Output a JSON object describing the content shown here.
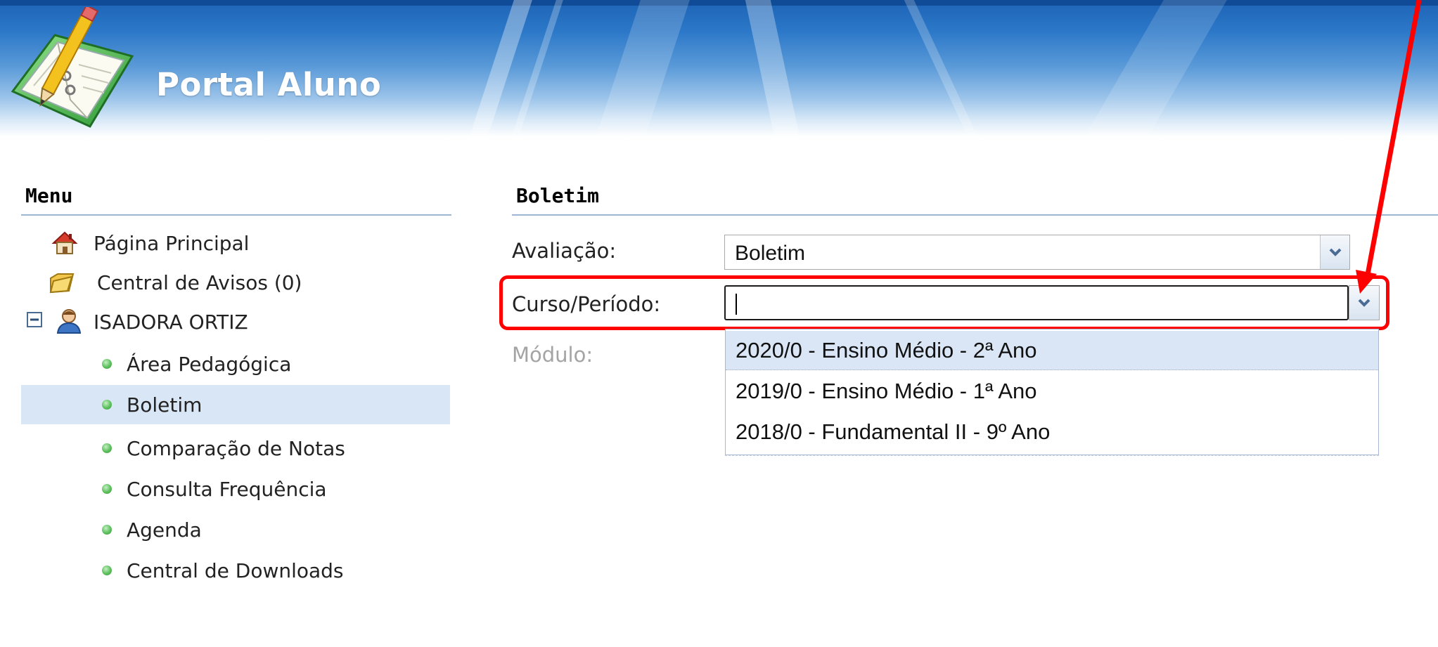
{
  "header": {
    "app_title": "Portal Aluno",
    "logo_icon": "notebook-pencil-icon"
  },
  "menu": {
    "title": "Menu",
    "items": [
      {
        "label": "Página Principal",
        "icon": "home-icon"
      },
      {
        "label": "Central de Avisos (0)",
        "icon": "folder-icon"
      },
      {
        "label": "ISADORA ORTIZ",
        "icon": "user-icon",
        "expander": "collapse-icon"
      }
    ],
    "subitems": [
      {
        "label": "Área Pedagógica"
      },
      {
        "label": "Boletim",
        "selected": true
      },
      {
        "label": "Comparação de Notas"
      },
      {
        "label": "Consulta Frequência"
      },
      {
        "label": "Agenda"
      },
      {
        "label": "Central de Downloads"
      }
    ]
  },
  "main": {
    "title": "Boletim",
    "fields": {
      "avaliacao": {
        "label": "Avaliação:",
        "value": "Boletim"
      },
      "curso": {
        "label": "Curso/Período:",
        "value": ""
      },
      "modulo": {
        "label": "Módulo:"
      }
    },
    "dropdown_options": [
      "2020/0 - Ensino Médio - 2ª Ano",
      "2019/0 - Ensino Médio - 1ª Ano",
      "2018/0 - Fundamental II - 9º Ano"
    ]
  },
  "colors": {
    "header_blue": "#2c78c8",
    "selected_row": "#d9e6f6",
    "annotation_red": "#ff0000",
    "bullet_green": "#5cbf5c"
  }
}
